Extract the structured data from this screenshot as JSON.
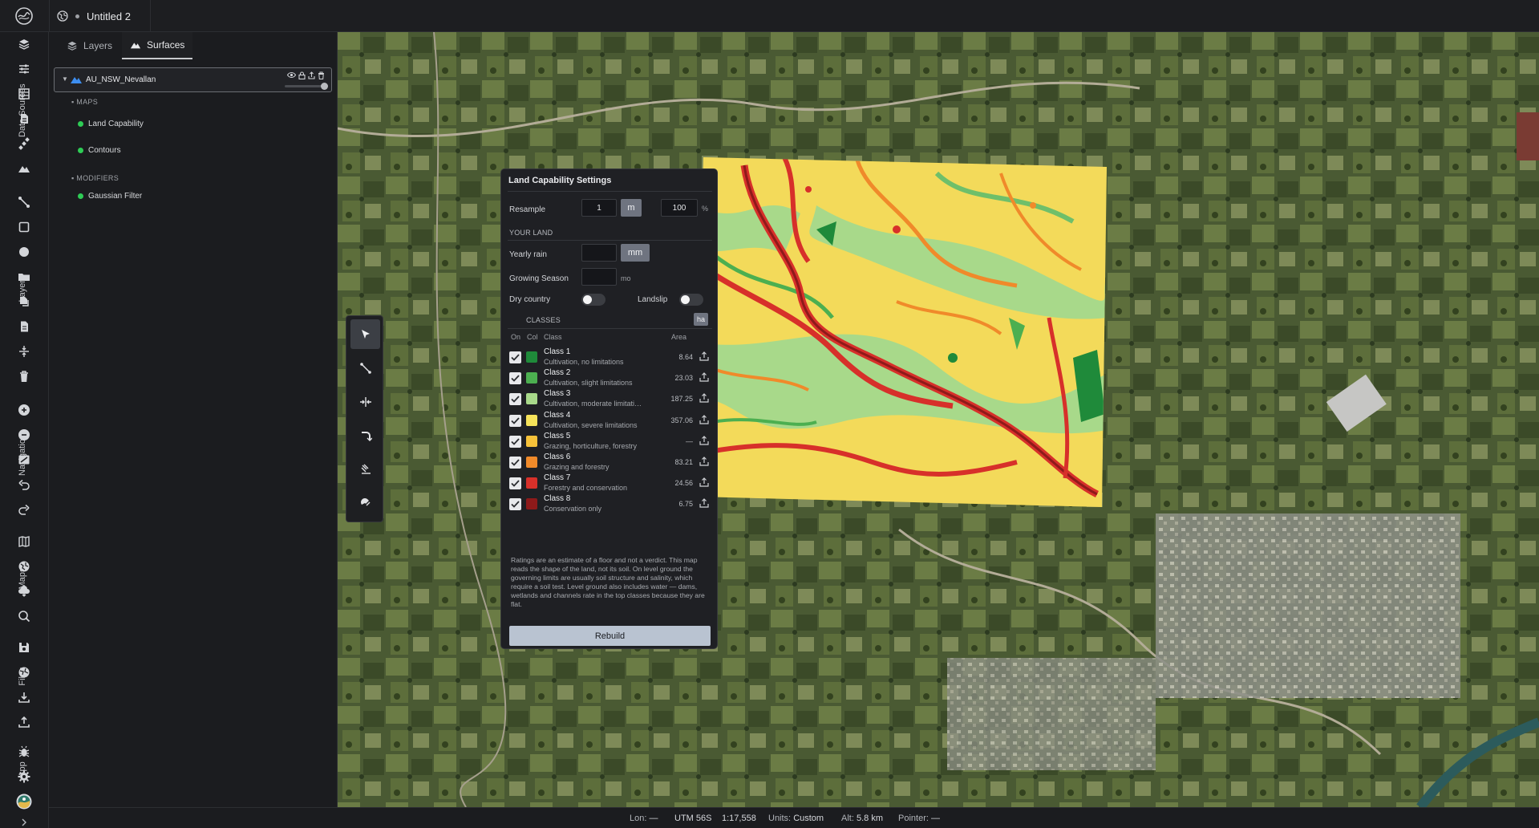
{
  "titlebar": {
    "doc_title": "Untitled 2"
  },
  "toolbar": {
    "sections": [
      "Data Sources",
      "Layers",
      "Navigation",
      "Maps",
      "Files",
      "App"
    ]
  },
  "panel": {
    "tabs": [
      {
        "label": "Layers",
        "active": false
      },
      {
        "label": "Surfaces",
        "active": true
      }
    ],
    "layer_name": "AU_NSW_Nevallan",
    "maps_heading": "MAPS",
    "maps": [
      "Land Capability",
      "Contours"
    ],
    "modifiers_heading": "MODIFIERS",
    "modifiers": [
      "Gaussian Filter"
    ]
  },
  "dialog": {
    "title": "Land Capability Settings",
    "resample_label": "Resample",
    "resample_value": "1",
    "resample_unit": "m",
    "resample_percent": "100",
    "percent_suffix": "%",
    "your_land_heading": "YOUR LAND",
    "yearly_rain_label": "Yearly rain",
    "yearly_rain_value": "",
    "yearly_rain_unit": "mm",
    "growing_season_label": "Growing Season",
    "growing_season_value": "",
    "growing_season_unit": "mo",
    "dry_country_label": "Dry country",
    "dry_country_on": false,
    "landslip_label": "Landslip",
    "landslip_on": false,
    "classes_heading": "CLASSES",
    "area_unit": "ha",
    "columns": {
      "on": "On",
      "col": "Col",
      "class": "Class",
      "area": "Area"
    },
    "classes": [
      {
        "name": "Class 1",
        "desc": "Cultivation, no limitations",
        "area": "8.64",
        "color": "#1f8a3a",
        "on": true
      },
      {
        "name": "Class 2",
        "desc": "Cultivation, slight limitations",
        "area": "23.03",
        "color": "#4caf50",
        "on": true
      },
      {
        "name": "Class 3",
        "desc": "Cultivation, moderate limitations",
        "area": "187.25",
        "color": "#a8d98a",
        "on": true
      },
      {
        "name": "Class 4",
        "desc": "Cultivation, severe limitations",
        "area": "357.06",
        "color": "#f6e35a",
        "on": true
      },
      {
        "name": "Class 5",
        "desc": "Grazing, horticulture, forestry",
        "area": "—",
        "color": "#f7c23a",
        "on": true
      },
      {
        "name": "Class 6",
        "desc": "Grazing and forestry",
        "area": "83.21",
        "color": "#f08a2a",
        "on": true
      },
      {
        "name": "Class 7",
        "desc": "Forestry and conservation",
        "area": "24.56",
        "color": "#d7302a",
        "on": true
      },
      {
        "name": "Class 8",
        "desc": "Conservation only",
        "area": "6.75",
        "color": "#8e1a1a",
        "on": true
      }
    ],
    "note": "Ratings are an estimate of a floor and not a verdict. This map reads the shape of the land, not its soil. On level ground the governing limits are usually soil structure and salinity, which require a soil test. Level ground also includes water — dams, wetlands and channels rate in the top classes because they are flat.",
    "rebuild_label": "Rebuild"
  },
  "status": {
    "lon_label": "Lon:",
    "lon_value": "—",
    "zone": "UTM 56S",
    "scale": "1:17,558",
    "units_label": "Units:",
    "units_value": "Custom",
    "alt_label": "Alt:",
    "alt_value": "5.8 km",
    "pointer_label": "Pointer:",
    "pointer_value": "—"
  }
}
